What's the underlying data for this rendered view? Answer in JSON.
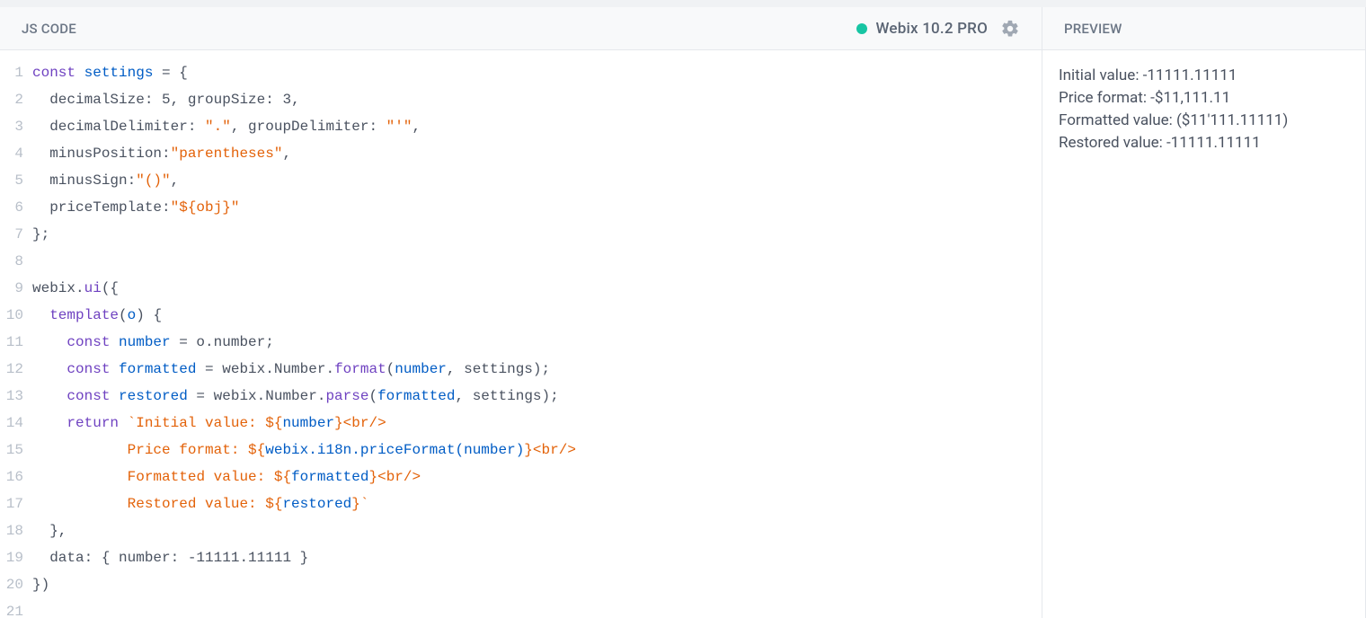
{
  "left": {
    "title": "JS CODE",
    "version": "Webix 10.2 PRO",
    "status_color": "#17c5a3"
  },
  "code": {
    "line_count": 21,
    "lines": [
      {
        "n": 1,
        "segments": [
          {
            "t": "const ",
            "c": "tok-kw"
          },
          {
            "t": "settings",
            "c": "tok-decl"
          },
          {
            "t": " = {",
            "c": ""
          }
        ]
      },
      {
        "n": 2,
        "segments": [
          {
            "t": "  decimalSize: ",
            "c": ""
          },
          {
            "t": "5",
            "c": ""
          },
          {
            "t": ", groupSize: ",
            "c": ""
          },
          {
            "t": "3",
            "c": ""
          },
          {
            "t": ",",
            "c": ""
          }
        ]
      },
      {
        "n": 3,
        "segments": [
          {
            "t": "  decimalDelimiter: ",
            "c": ""
          },
          {
            "t": "\".\"",
            "c": "tok-str"
          },
          {
            "t": ", groupDelimiter: ",
            "c": ""
          },
          {
            "t": "\"'\"",
            "c": "tok-str"
          },
          {
            "t": ",",
            "c": ""
          }
        ]
      },
      {
        "n": 4,
        "segments": [
          {
            "t": "  minusPosition:",
            "c": ""
          },
          {
            "t": "\"parentheses\"",
            "c": "tok-str"
          },
          {
            "t": ",",
            "c": ""
          }
        ]
      },
      {
        "n": 5,
        "segments": [
          {
            "t": "  minusSign:",
            "c": ""
          },
          {
            "t": "\"()\"",
            "c": "tok-str"
          },
          {
            "t": ",",
            "c": ""
          }
        ]
      },
      {
        "n": 6,
        "segments": [
          {
            "t": "  priceTemplate:",
            "c": ""
          },
          {
            "t": "\"${obj}\"",
            "c": "tok-str"
          }
        ]
      },
      {
        "n": 7,
        "segments": [
          {
            "t": "};",
            "c": ""
          }
        ]
      },
      {
        "n": 8,
        "segments": [
          {
            "t": "",
            "c": ""
          }
        ]
      },
      {
        "n": 9,
        "segments": [
          {
            "t": "webix.",
            "c": ""
          },
          {
            "t": "ui",
            "c": "tok-fn"
          },
          {
            "t": "({",
            "c": ""
          }
        ]
      },
      {
        "n": 10,
        "segments": [
          {
            "t": "  ",
            "c": ""
          },
          {
            "t": "template",
            "c": "tok-fn"
          },
          {
            "t": "(",
            "c": ""
          },
          {
            "t": "o",
            "c": "tok-decl"
          },
          {
            "t": ") {",
            "c": ""
          }
        ]
      },
      {
        "n": 11,
        "segments": [
          {
            "t": "    ",
            "c": ""
          },
          {
            "t": "const ",
            "c": "tok-kw"
          },
          {
            "t": "number",
            "c": "tok-decl"
          },
          {
            "t": " = o.number;",
            "c": ""
          }
        ]
      },
      {
        "n": 12,
        "segments": [
          {
            "t": "    ",
            "c": ""
          },
          {
            "t": "const ",
            "c": "tok-kw"
          },
          {
            "t": "formatted",
            "c": "tok-decl"
          },
          {
            "t": " = webix.Number.",
            "c": ""
          },
          {
            "t": "format",
            "c": "tok-fn"
          },
          {
            "t": "(",
            "c": ""
          },
          {
            "t": "number",
            "c": "tok-decl"
          },
          {
            "t": ", settings);",
            "c": ""
          }
        ]
      },
      {
        "n": 13,
        "segments": [
          {
            "t": "    ",
            "c": ""
          },
          {
            "t": "const ",
            "c": "tok-kw"
          },
          {
            "t": "restored",
            "c": "tok-decl"
          },
          {
            "t": " = webix.Number.",
            "c": ""
          },
          {
            "t": "parse",
            "c": "tok-fn"
          },
          {
            "t": "(",
            "c": ""
          },
          {
            "t": "formatted",
            "c": "tok-decl"
          },
          {
            "t": ", settings);",
            "c": ""
          }
        ]
      },
      {
        "n": 14,
        "segments": [
          {
            "t": "    ",
            "c": ""
          },
          {
            "t": "return ",
            "c": "tok-kw"
          },
          {
            "t": "`Initial value: ",
            "c": "tok-str"
          },
          {
            "t": "${",
            "c": "tok-str"
          },
          {
            "t": "number",
            "c": "tok-tpl-var"
          },
          {
            "t": "}",
            "c": "tok-str"
          },
          {
            "t": "<br/>",
            "c": "tok-str"
          }
        ]
      },
      {
        "n": 15,
        "segments": [
          {
            "t": "           ",
            "c": ""
          },
          {
            "t": "Price format: ",
            "c": "tok-str"
          },
          {
            "t": "${",
            "c": "tok-str"
          },
          {
            "t": "webix.i18n.priceFormat(number)",
            "c": "tok-tpl-var"
          },
          {
            "t": "}",
            "c": "tok-str"
          },
          {
            "t": "<br/>",
            "c": "tok-str"
          }
        ]
      },
      {
        "n": 16,
        "segments": [
          {
            "t": "           ",
            "c": ""
          },
          {
            "t": "Formatted value: ",
            "c": "tok-str"
          },
          {
            "t": "${",
            "c": "tok-str"
          },
          {
            "t": "formatted",
            "c": "tok-tpl-var"
          },
          {
            "t": "}",
            "c": "tok-str"
          },
          {
            "t": "<br/>",
            "c": "tok-str"
          }
        ]
      },
      {
        "n": 17,
        "segments": [
          {
            "t": "           ",
            "c": ""
          },
          {
            "t": "Restored value: ",
            "c": "tok-str"
          },
          {
            "t": "${",
            "c": "tok-str"
          },
          {
            "t": "restored",
            "c": "tok-tpl-var"
          },
          {
            "t": "}`",
            "c": "tok-str"
          }
        ]
      },
      {
        "n": 18,
        "segments": [
          {
            "t": "  },",
            "c": ""
          }
        ]
      },
      {
        "n": 19,
        "segments": [
          {
            "t": "  data: { number: ",
            "c": ""
          },
          {
            "t": "-11111.11111",
            "c": ""
          },
          {
            "t": " }",
            "c": ""
          }
        ]
      },
      {
        "n": 20,
        "segments": [
          {
            "t": "})",
            "c": ""
          }
        ]
      },
      {
        "n": 21,
        "segments": [
          {
            "t": "",
            "c": ""
          }
        ]
      }
    ]
  },
  "right": {
    "title": "PREVIEW",
    "lines": [
      "Initial value: -11111.11111",
      "Price format: -$11,111.11",
      "Formatted value: ($11'111.11111)",
      "Restored value: -11111.11111"
    ]
  }
}
